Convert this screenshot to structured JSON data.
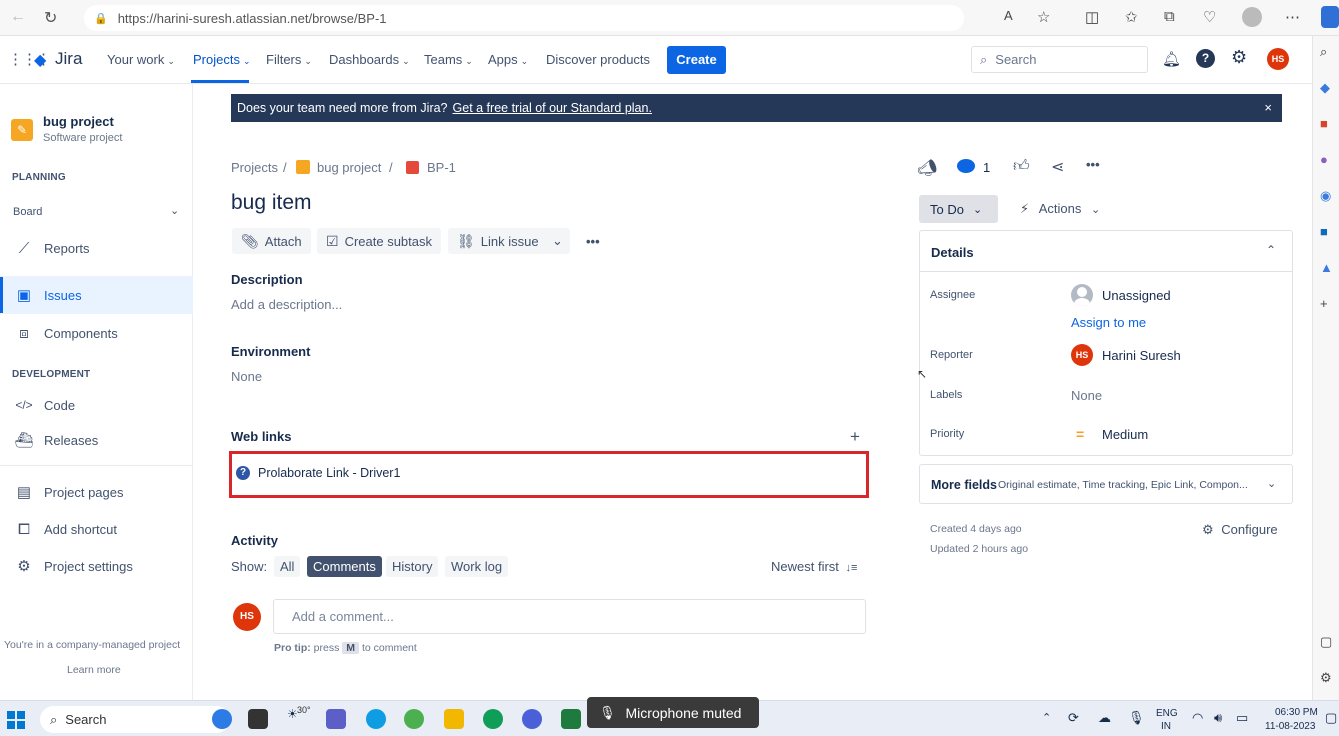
{
  "browser": {
    "url": "https://harini-suresh.atlassian.net/browse/BP-1"
  },
  "header": {
    "logo_text": "Jira",
    "nav": [
      "Your work",
      "Projects",
      "Filters",
      "Dashboards",
      "Teams",
      "Apps"
    ],
    "discover": "Discover products",
    "create_label": "Create",
    "search_placeholder": "Search",
    "avatar_initials": "HS"
  },
  "sidebar": {
    "project_name": "bug project",
    "project_type": "Software project",
    "planning_heading": "PLANNING",
    "board_label": "Board",
    "items_planning": [
      "Reports",
      "Issues",
      "Components"
    ],
    "development_heading": "DEVELOPMENT",
    "items_dev": [
      "Code",
      "Releases"
    ],
    "items_other": [
      "Project pages",
      "Add shortcut",
      "Project settings"
    ],
    "footer_text": "You're in a company-managed project",
    "learn_more": "Learn more"
  },
  "banner": {
    "text": "Does your team need more from Jira?",
    "link": "Get a free trial of our Standard plan.",
    "close": "×"
  },
  "breadcrumb": {
    "projects": "Projects",
    "project": "bug project",
    "issue": "BP-1",
    "sep": "/"
  },
  "issue": {
    "title": "bug item",
    "toolbar": {
      "attach": "Attach",
      "subtask": "Create subtask",
      "link": "Link issue"
    },
    "description_label": "Description",
    "description_placeholder": "Add a description...",
    "environment_label": "Environment",
    "environment_value": "None",
    "weblinks_label": "Web links",
    "weblink_text": "Prolaborate Link - Driver1",
    "activity_label": "Activity",
    "show_label": "Show:",
    "filters": [
      "All",
      "Comments",
      "History",
      "Work log"
    ],
    "sort_label": "Newest first",
    "comment_avatar": "HS",
    "comment_placeholder": "Add a comment...",
    "protip_prefix": "Pro tip:",
    "protip_press": "press",
    "protip_key": "M",
    "protip_suffix": "to comment"
  },
  "right_panel": {
    "watch_count": "1",
    "status": "To Do",
    "actions": "Actions",
    "details_title": "Details",
    "assignee_label": "Assignee",
    "assignee_value": "Unassigned",
    "assign_to_me": "Assign to me",
    "reporter_label": "Reporter",
    "reporter_initials": "HS",
    "reporter_value": "Harini Suresh",
    "labels_label": "Labels",
    "labels_value": "None",
    "priority_label": "Priority",
    "priority_value": "Medium",
    "more_fields": "More fields",
    "more_fields_sub": "Original estimate, Time tracking, Epic Link, Compon...",
    "created": "Created 4 days ago",
    "updated": "Updated 2 hours ago",
    "configure": "Configure"
  },
  "taskbar": {
    "search": "Search",
    "weather": "30°",
    "mic_muted": "Microphone muted",
    "lang_line1": "ENG",
    "lang_line2": "IN",
    "time": "06:30 PM",
    "date": "11-08-2023"
  },
  "colors": {
    "accent": "#0c66e4",
    "banner": "#253858",
    "highlight": "#d9262a",
    "avatar": "#de350b"
  }
}
